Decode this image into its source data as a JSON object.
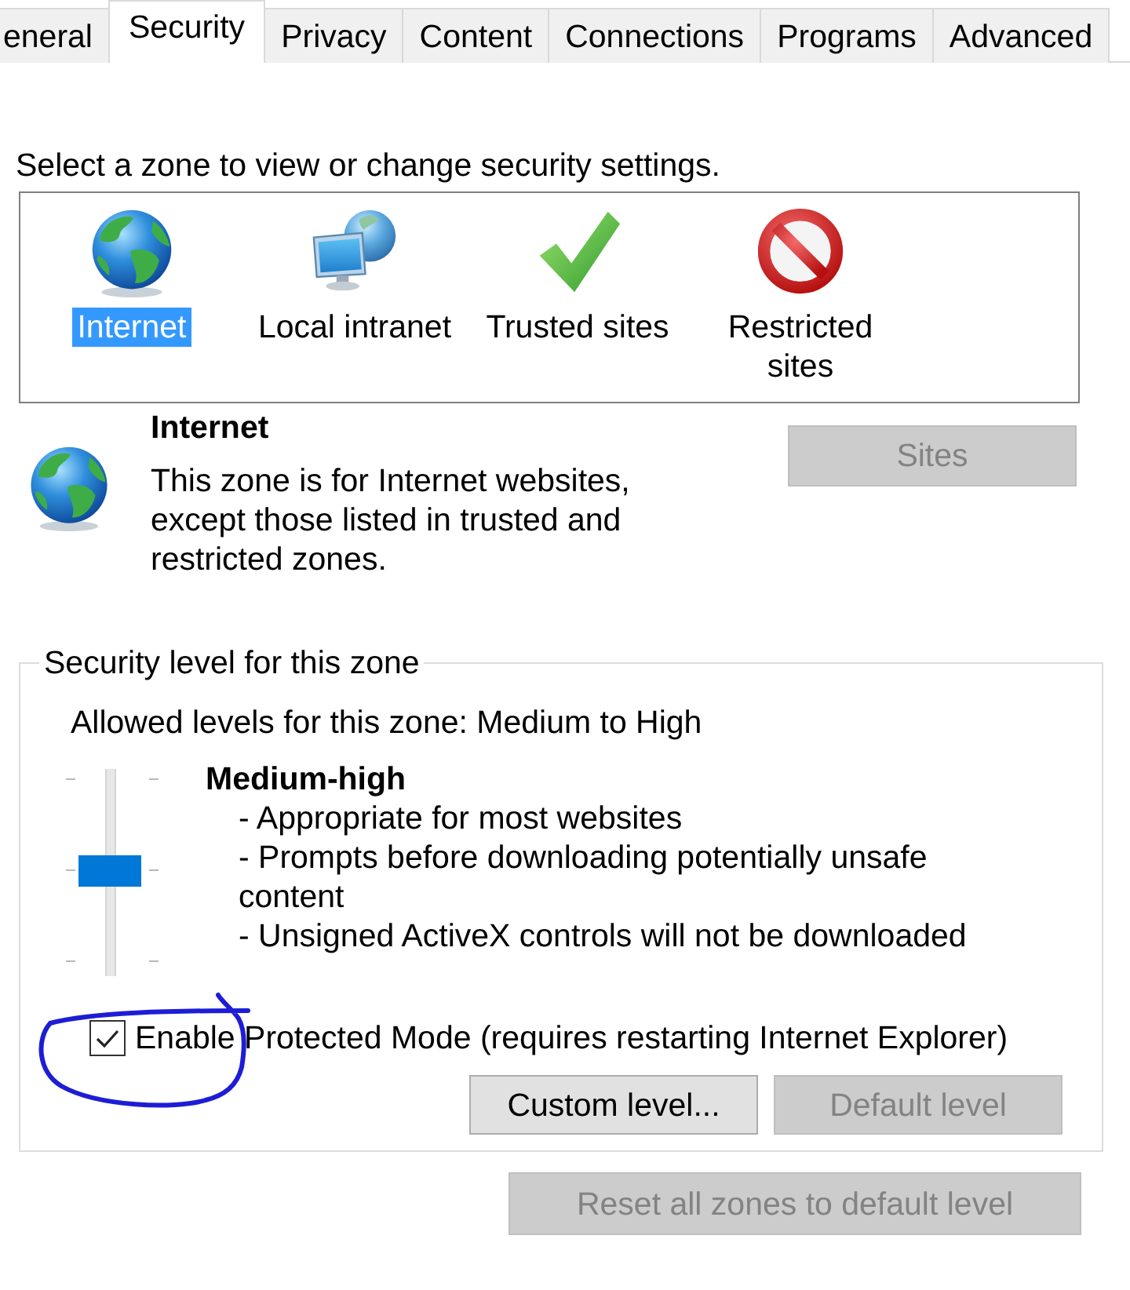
{
  "tabs": [
    {
      "label": "eneral",
      "selected": false
    },
    {
      "label": "Security",
      "selected": true
    },
    {
      "label": "Privacy",
      "selected": false
    },
    {
      "label": "Content",
      "selected": false
    },
    {
      "label": "Connections",
      "selected": false
    },
    {
      "label": "Programs",
      "selected": false
    },
    {
      "label": "Advanced",
      "selected": false
    }
  ],
  "zone_prompt": "Select a zone to view or change security settings.",
  "zones": [
    {
      "kind": "globe",
      "label": "Internet",
      "selected": true
    },
    {
      "kind": "intranet",
      "label": "Local intranet",
      "selected": false
    },
    {
      "kind": "trusted",
      "label": "Trusted sites",
      "selected": false
    },
    {
      "kind": "restricted",
      "label": "Restricted sites",
      "selected": false
    }
  ],
  "zone_info": {
    "kind": "globe",
    "title": "Internet",
    "description": "This zone is for Internet websites, except those listed in trusted and restricted zones.",
    "sites_button": {
      "label": "Sites",
      "disabled": true
    }
  },
  "security_level": {
    "legend": "Security level for this zone",
    "allowed_levels": "Allowed levels for this zone: Medium to High",
    "slider": {
      "level": 0.5
    },
    "level_name": "Medium-high",
    "details": [
      "- Appropriate for most websites",
      "- Prompts before downloading potentially unsafe content",
      "- Unsigned ActiveX controls will not be downloaded"
    ],
    "protected_mode": {
      "label": "Enable Protected Mode (requires restarting Internet Explorer)",
      "checked": true
    },
    "buttons": [
      {
        "label": "Custom level...",
        "disabled": false
      },
      {
        "label": "Default level",
        "disabled": true
      }
    ]
  },
  "reset_button": {
    "label": "Reset all zones to default level",
    "disabled": true
  },
  "annotations": [
    {
      "kind": "freehand-circle"
    }
  ]
}
